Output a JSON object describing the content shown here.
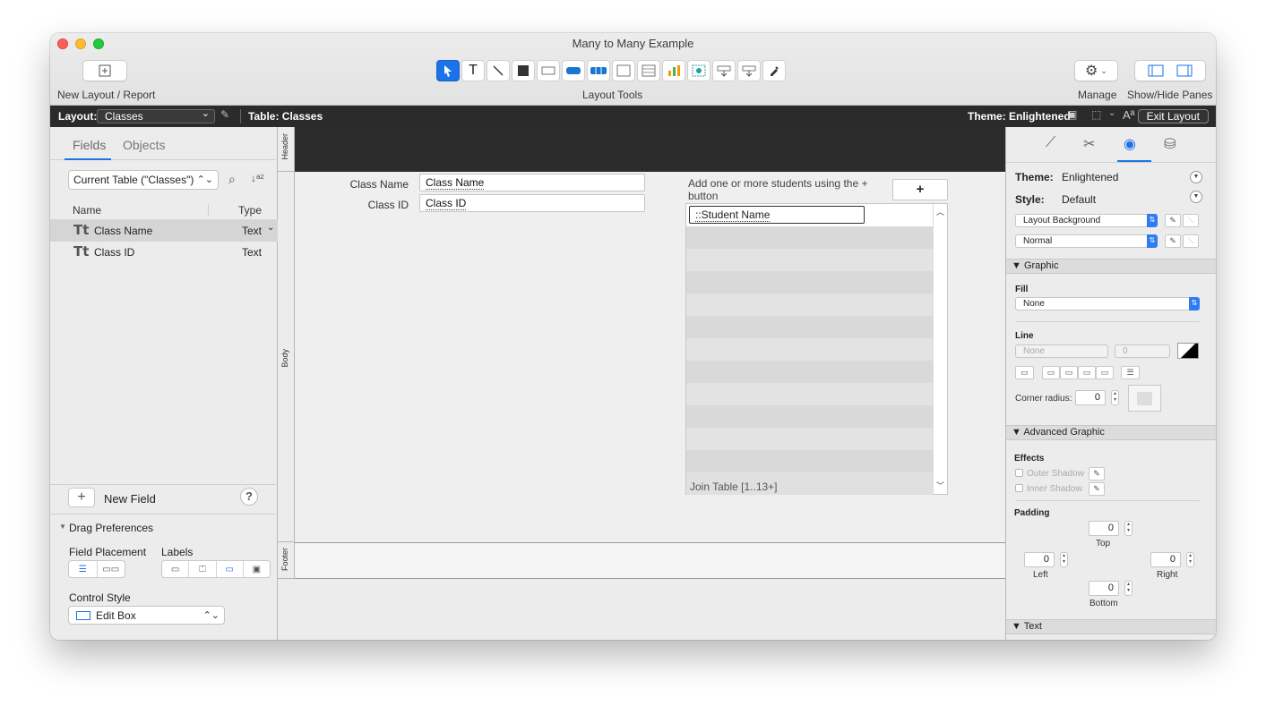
{
  "window": {
    "title": "Many to Many Example"
  },
  "toolbar": {
    "new_layout_label": "New Layout / Report",
    "layout_tools_label": "Layout Tools",
    "manage_label": "Manage",
    "show_hide_label": "Show/Hide Panes"
  },
  "layout_bar": {
    "layout_label": "Layout:",
    "layout_value": "Classes",
    "table_label": "Table: Classes",
    "theme_label": "Theme: Enlightened",
    "exit_label": "Exit Layout"
  },
  "left_pane": {
    "tabs": [
      "Fields",
      "Objects"
    ],
    "table_select": "Current Table (\"Classes\")",
    "columns": {
      "name": "Name",
      "type": "Type"
    },
    "fields": [
      {
        "name": "Class Name",
        "type": "Text"
      },
      {
        "name": "Class ID",
        "type": "Text"
      }
    ],
    "new_field_label": "New Field",
    "help_label": "?",
    "drag_prefs": {
      "title": "Drag Preferences",
      "field_placement": "Field Placement",
      "labels": "Labels",
      "control_style": "Control Style",
      "control_style_value": "Edit Box"
    }
  },
  "canvas": {
    "parts": {
      "header": "Header",
      "body": "Body",
      "footer": "Footer"
    },
    "fields": [
      {
        "label": "Class Name",
        "value": "Class Name"
      },
      {
        "label": "Class ID",
        "value": "Class ID"
      }
    ],
    "portal": {
      "instruction": "Add one or more students using the + button",
      "add_button": "+",
      "field": "::Student Name",
      "footer": "Join Table [1..13+]"
    }
  },
  "right_pane": {
    "theme_label": "Theme:",
    "theme_value": "Enlightened",
    "style_label": "Style:",
    "style_value": "Default",
    "object_select": "Layout Background",
    "state_select": "Normal",
    "graphic": {
      "title": "Graphic",
      "fill_label": "Fill",
      "fill_value": "None",
      "line_label": "Line",
      "line_value": "None",
      "line_width": "0",
      "corner_radius_label": "Corner radius:",
      "corner_radius": "0"
    },
    "advanced": {
      "title": "Advanced Graphic",
      "effects_label": "Effects",
      "outer_shadow": "Outer Shadow",
      "inner_shadow": "Inner Shadow",
      "padding_label": "Padding",
      "top": "0",
      "left": "0",
      "right": "0",
      "bottom": "0",
      "top_label": "Top",
      "left_label": "Left",
      "right_label": "Right",
      "bottom_label": "Bottom"
    },
    "text_section": "Text"
  }
}
